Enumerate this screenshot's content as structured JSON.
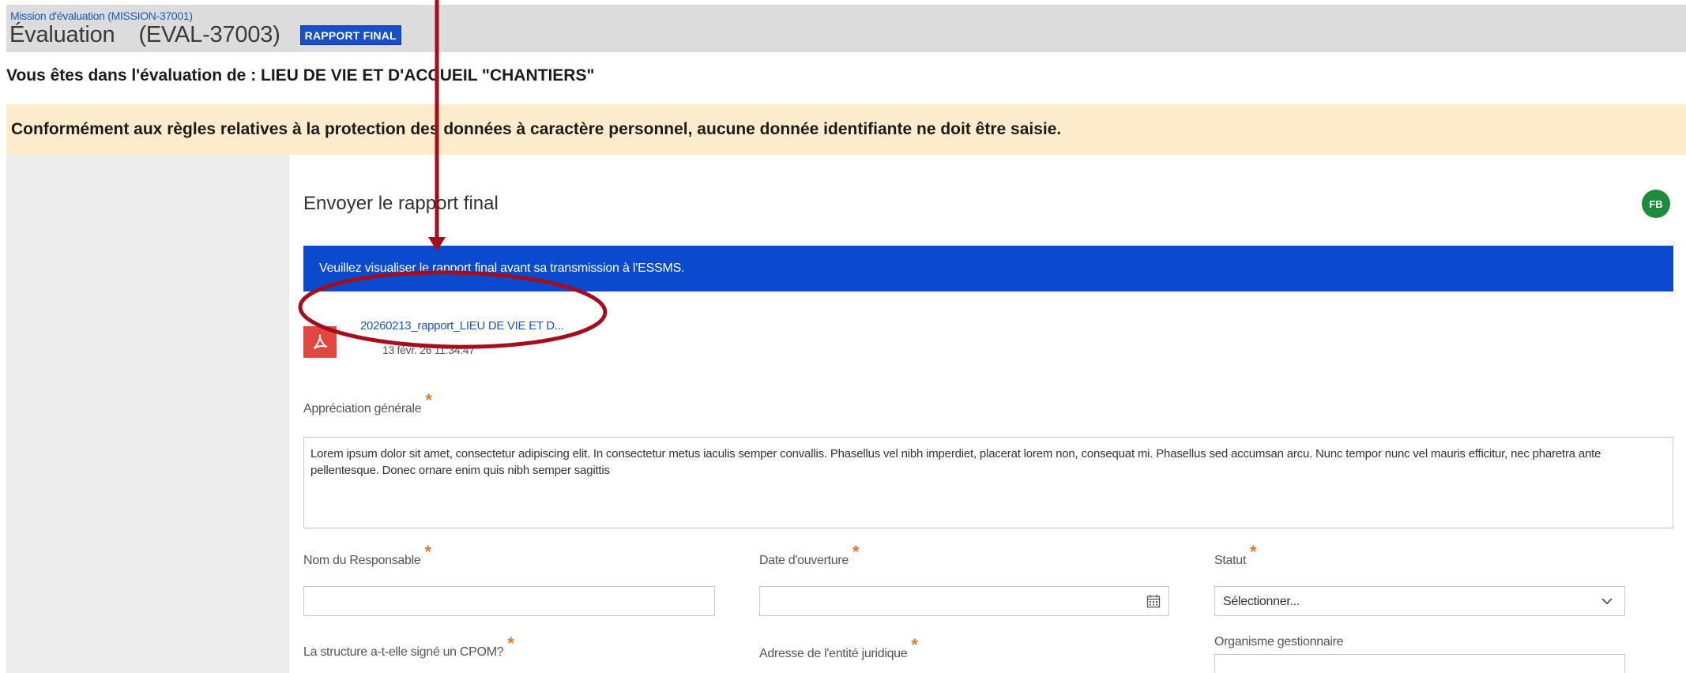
{
  "header": {
    "breadcrumb": "Mission d'évaluation (MISSION-37001)",
    "title": "Évaluation",
    "code": "(EVAL-37003)",
    "badge": "RAPPORT FINAL"
  },
  "context": {
    "text": "Vous êtes dans l'évaluation de : LIEU DE VIE ET D'ACCUEIL \"CHANTIERS\""
  },
  "warning": {
    "text": "Conformément aux règles relatives à la protection des données à caractère personnel, aucune donnée identifiante ne doit être saisie."
  },
  "card": {
    "title": "Envoyer le rapport final",
    "avatar": "FB",
    "banner": "Veuillez visualiser le rapport final avant sa transmission à l'ESSMS.",
    "file": {
      "name": "20260213_rapport_LIEU DE VIE ET D...",
      "date": "13 févr. 26 11:34:47",
      "icon": "pdf-icon"
    },
    "fields": {
      "appreciation_label": "Appréciation générale",
      "appreciation_value": "Lorem ipsum dolor sit amet, consectetur adipiscing elit. In consectetur metus iaculis semper convallis. Phasellus vel nibh imperdiet, placerat lorem non, consequat mi. Phasellus sed accumsan arcu. Nunc tempor nunc vel mauris efficitur, nec pharetra ante pellentesque. Donec ornare enim quis nibh semper sagittis",
      "responsable_label": "Nom du Responsable",
      "responsable_value": "",
      "date_label": "Date d'ouverture",
      "date_value": "",
      "statut_label": "Statut",
      "statut_value": "Sélectionner...",
      "cpom_label": "La structure a-t-elle signé un CPOM?",
      "adresse_label": "Adresse de l'entité juridique",
      "organisme_label": "Organisme gestionnaire"
    },
    "required_mark": "*"
  },
  "colors": {
    "accent": "#0a4bcd",
    "badge": "#1750c8",
    "warning_bg": "#fdeccb",
    "annotation": "#a50d1c",
    "avatar": "#1e8a3c",
    "pdf": "#e0483f"
  }
}
